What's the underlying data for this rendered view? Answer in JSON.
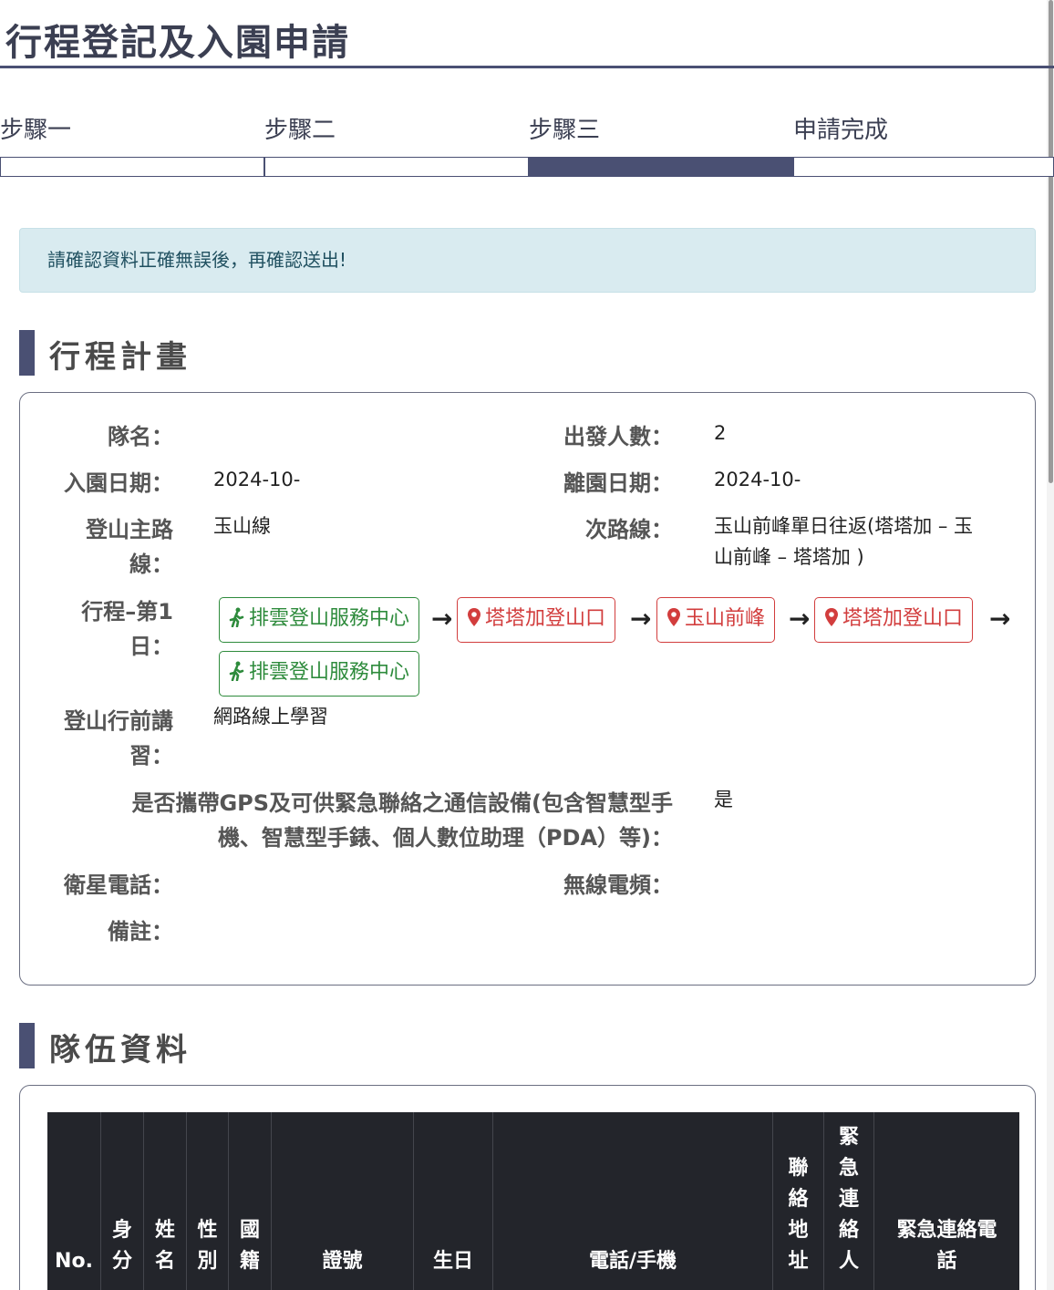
{
  "page": {
    "title": "行程登記及入園申請"
  },
  "steps": [
    {
      "label": "步驟一",
      "active": false
    },
    {
      "label": "步驟二",
      "active": false
    },
    {
      "label": "步驟三",
      "active": true
    },
    {
      "label": "申請完成",
      "active": false
    }
  ],
  "alert": {
    "text": "請確認資料正確無誤後，再確認送出!"
  },
  "itinerary": {
    "heading": "行程計畫",
    "team_name_label": "隊名：",
    "team_name_value": "",
    "people_label": "出發人數：",
    "people_value": "2",
    "enter_date_label": "入園日期：",
    "enter_date_value": "2024-10-",
    "leave_date_label": "離園日期：",
    "leave_date_value": "2024-10-",
    "main_route_label_line1": "登山主路",
    "main_route_label_line2": "線：",
    "main_route_value": "玉山線",
    "sub_route_label": "次路線：",
    "sub_route_value_line1": "玉山前峰單日往返(塔塔加 – 玉",
    "sub_route_value_line2": "山前峰 – 塔塔加 )",
    "day1_label_line1": "行程–第1",
    "day1_label_line2": "日：",
    "day1_route": [
      {
        "name": "排雲登山服務中心",
        "type": "start",
        "icon": "hiker-icon"
      },
      {
        "name": "塔塔加登山口",
        "type": "point",
        "icon": "map-pin-icon"
      },
      {
        "name": "玉山前峰",
        "type": "point",
        "icon": "map-pin-icon"
      },
      {
        "name": "塔塔加登山口",
        "type": "point",
        "icon": "map-pin-icon"
      },
      {
        "name": "排雲登山服務中心",
        "type": "start",
        "icon": "hiker-icon"
      }
    ],
    "briefing_label_line1": "登山行前講",
    "briefing_label_line2": "習：",
    "briefing_value": "網路線上學習",
    "gps_label_line1": "是否攜帶GPS及可供緊急聯絡之通信設備(包含智慧型手",
    "gps_label_line2": "機、智慧型手錶、個人數位助理（PDA）等)：",
    "gps_value": "是",
    "sat_phone_label": "衛星電話：",
    "radio_label": "無線電頻：",
    "note_label": "備註："
  },
  "team": {
    "heading": "隊伍資料",
    "columns": {
      "no": "No.",
      "identity": "身分",
      "name": "姓名",
      "gender": "性別",
      "nationality": "國籍",
      "id_number": "證號",
      "birthday": "生日",
      "phone": "電話/手機",
      "address": "聯絡地址",
      "emergency_contact": "緊急連絡人",
      "emergency_phone": "緊急連絡電話"
    }
  },
  "colors": {
    "primary": "#4a5073",
    "green": "#2e8b3c",
    "red": "#d23d3d",
    "alert_bg": "#d9ebf0"
  }
}
